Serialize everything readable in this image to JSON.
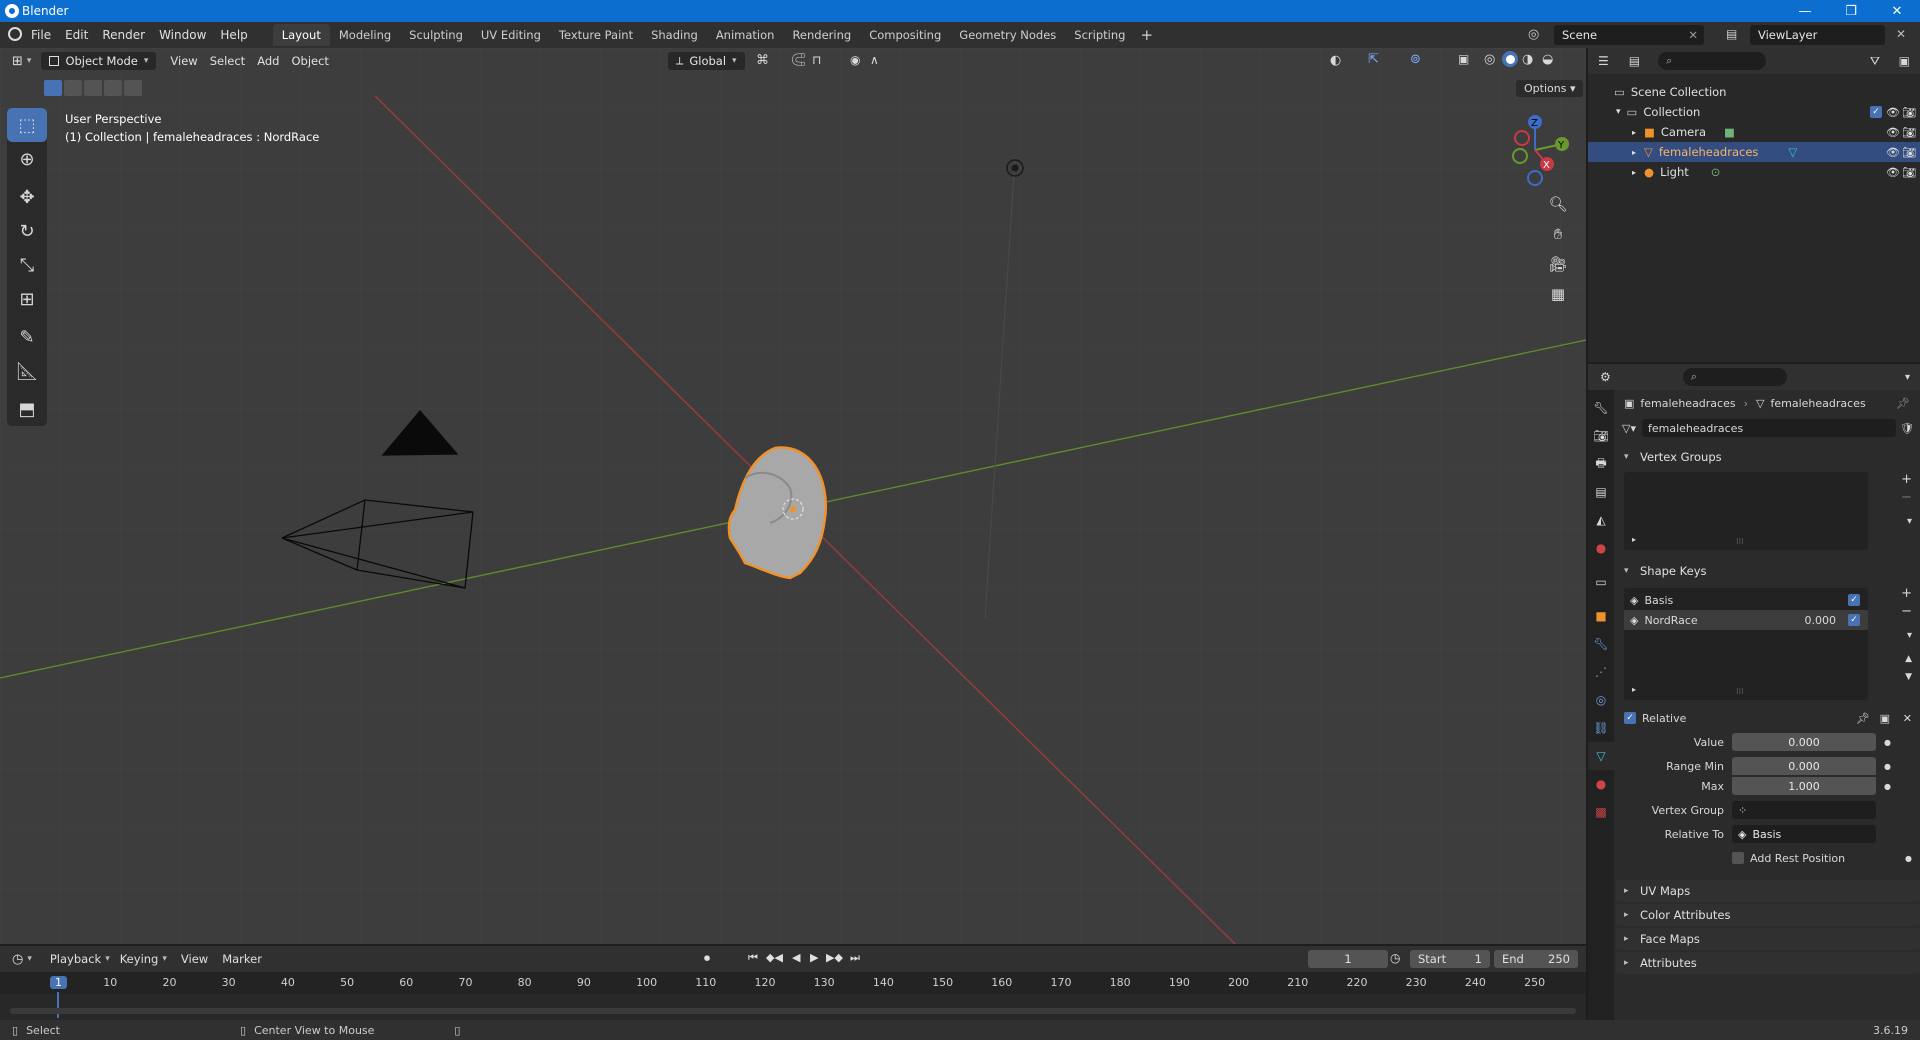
{
  "window": {
    "title": "Blender",
    "controls": [
      "—",
      "❐",
      "✕"
    ]
  },
  "menu": [
    "File",
    "Edit",
    "Render",
    "Window",
    "Help"
  ],
  "workspaces": [
    "Layout",
    "Modeling",
    "Sculpting",
    "UV Editing",
    "Texture Paint",
    "Shading",
    "Animation",
    "Rendering",
    "Compositing",
    "Geometry Nodes",
    "Scripting"
  ],
  "active_workspace": "Layout",
  "scene": {
    "name": "Scene",
    "view_layer": "ViewLayer"
  },
  "viewport": {
    "mode": "Object Mode",
    "menus": [
      "View",
      "Select",
      "Add",
      "Object"
    ],
    "orientation": "Global",
    "options_label": "Options",
    "info_line1": "User Perspective",
    "info_line2": "(1) Collection | femaleheadraces : NordRace",
    "gizmo_axes": {
      "x": "X",
      "y": "Y",
      "z": "Z"
    }
  },
  "outliner": {
    "scene_collection": "Scene Collection",
    "collection": "Collection",
    "items": [
      {
        "name": "Camera",
        "icon": "camera-icon"
      },
      {
        "name": "femaleheadraces",
        "icon": "mesh-icon",
        "selected": true
      },
      {
        "name": "Light",
        "icon": "light-icon"
      }
    ]
  },
  "properties": {
    "breadcrumb_object": "femaleheadraces",
    "breadcrumb_data": "femaleheadraces",
    "mesh_name": "femaleheadraces",
    "panels": {
      "vertex_groups": "Vertex Groups",
      "shape_keys": "Shape Keys",
      "uv_maps": "UV Maps",
      "color_attributes": "Color Attributes",
      "face_maps": "Face Maps",
      "attributes": "Attributes"
    },
    "shape_keys": [
      {
        "name": "Basis",
        "value": "",
        "enabled": true
      },
      {
        "name": "NordRace",
        "value": "0.000",
        "enabled": true,
        "selected": true
      }
    ],
    "relative_label": "Relative",
    "fields": {
      "value_label": "Value",
      "value": "0.000",
      "range_min_label": "Range Min",
      "range_min": "0.000",
      "max_label": "Max",
      "max": "1.000",
      "vertex_group_label": "Vertex Group",
      "vertex_group": "",
      "relative_to_label": "Relative To",
      "relative_to": "Basis",
      "add_rest_label": "Add Rest Position"
    }
  },
  "timeline": {
    "menus": [
      "Playback",
      "Keying",
      "View",
      "Marker"
    ],
    "current_frame": "1",
    "start_label": "Start",
    "start": "1",
    "end_label": "End",
    "end": "250",
    "ticks": [
      "1",
      "10",
      "20",
      "30",
      "40",
      "50",
      "60",
      "70",
      "80",
      "90",
      "100",
      "110",
      "120",
      "130",
      "140",
      "150",
      "160",
      "170",
      "180",
      "190",
      "200",
      "210",
      "220",
      "230",
      "240",
      "250"
    ]
  },
  "status": {
    "left": "Select",
    "middle": "Center View to Mouse",
    "version": "3.6.19"
  },
  "colors": {
    "accent": "#4772b3",
    "titlebar": "#0c6fd0",
    "selection_orange": "#f0922c"
  }
}
